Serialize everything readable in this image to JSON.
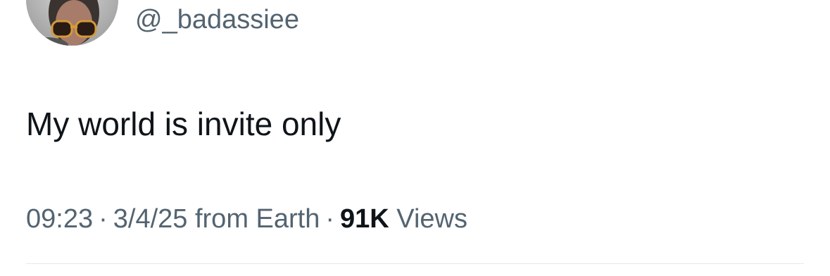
{
  "author": {
    "handle": "@_badassiee",
    "avatar": "profile-photo-woman-sunglasses"
  },
  "tweet": {
    "text": "My world is invite only"
  },
  "meta": {
    "time": "09:23",
    "separator": "·",
    "date": "3/4/25",
    "source": "from Earth",
    "views_count": "91K",
    "views_label": "Views"
  },
  "colors": {
    "text_primary": "#0f1419",
    "text_secondary": "#536471",
    "divider": "#e7e9ea"
  }
}
